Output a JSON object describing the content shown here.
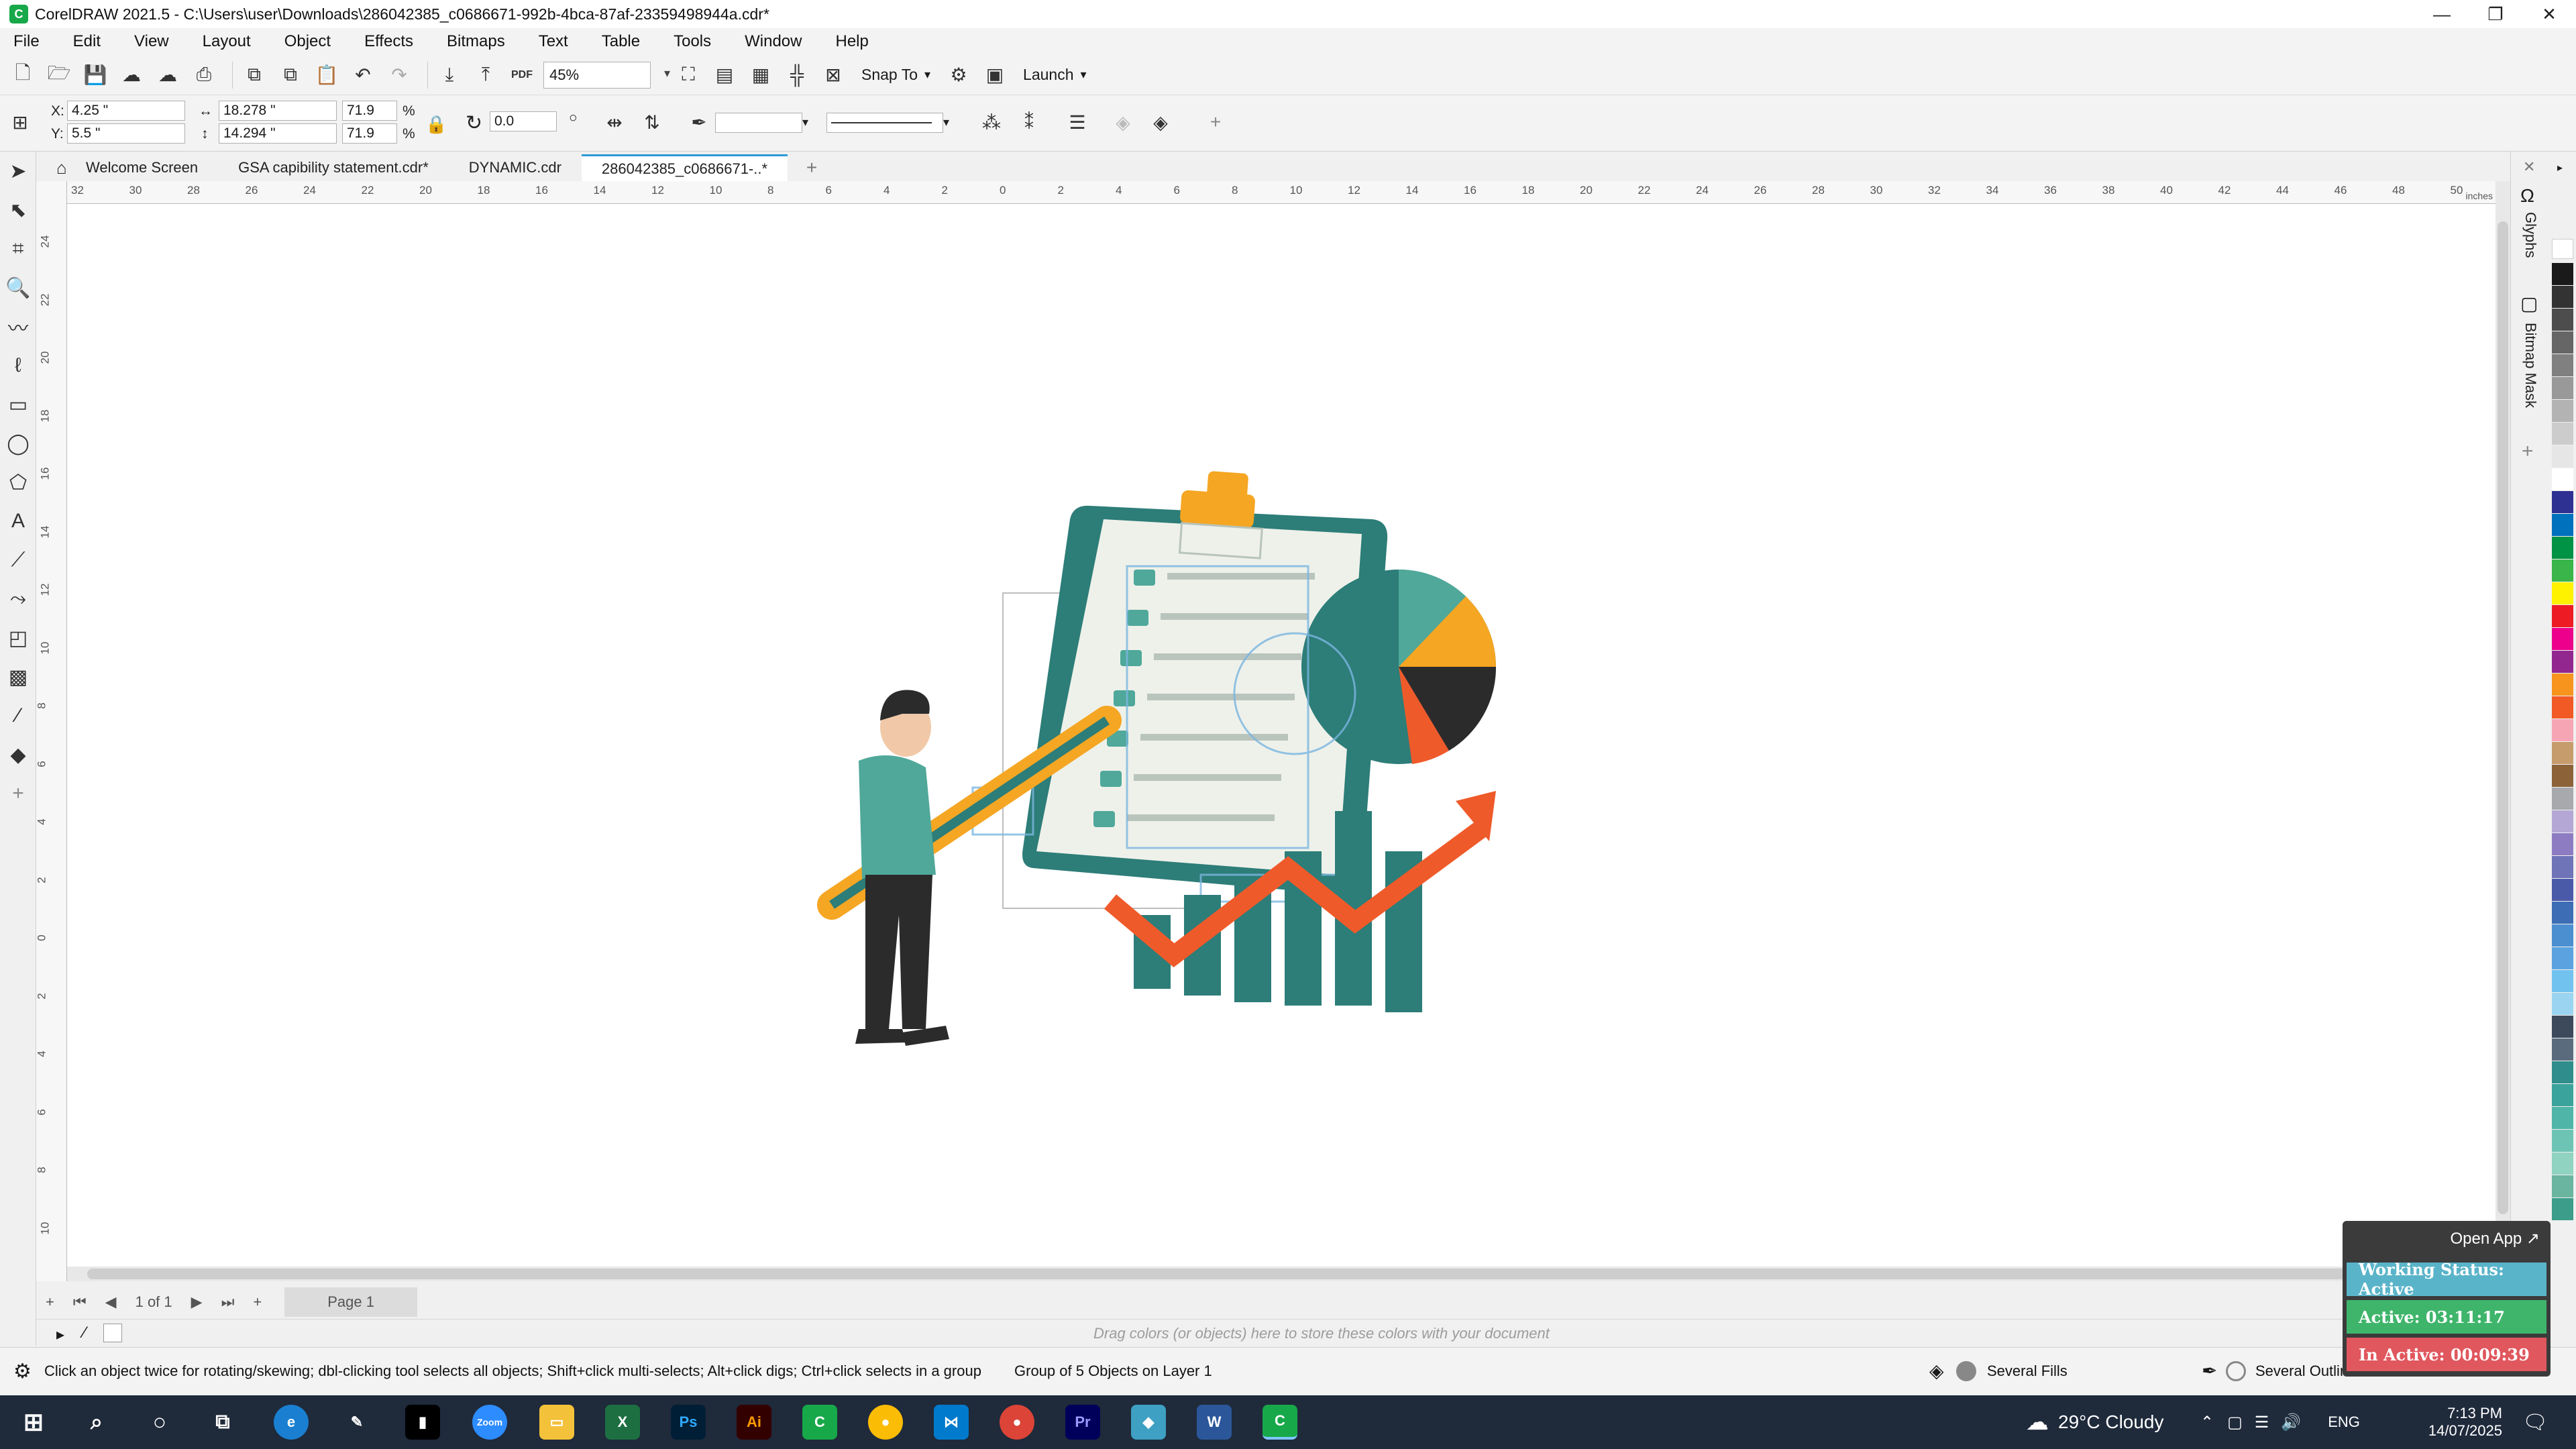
{
  "window": {
    "title": "CorelDRAW 2021.5 - C:\\Users\\user\\Downloads\\286042385_c0686671-992b-4bca-87af-23359498944a.cdr*"
  },
  "menu": [
    "File",
    "Edit",
    "View",
    "Layout",
    "Object",
    "Effects",
    "Bitmaps",
    "Text",
    "Table",
    "Tools",
    "Window",
    "Help"
  ],
  "toolbar": {
    "zoom": "45%",
    "snap_label": "Snap To",
    "launch_label": "Launch"
  },
  "properties": {
    "x_label": "X:",
    "x_value": "4.25 \"",
    "y_label": "Y:",
    "y_value": "5.5 \"",
    "width_value": "18.278 \"",
    "height_value": "14.294 \"",
    "scale_w": "71.9",
    "scale_h": "71.9",
    "percent": "%",
    "rotation": "0.0"
  },
  "tabs": [
    "Welcome Screen",
    "GSA  capibility statement.cdr*",
    "DYNAMIC.cdr",
    "286042385_c0686671-..*"
  ],
  "ruler": {
    "h_labels": [
      "32",
      "30",
      "28",
      "26",
      "24",
      "22",
      "20",
      "18",
      "16",
      "14",
      "12",
      "10",
      "8",
      "6",
      "4",
      "2",
      "0",
      "2",
      "4",
      "6",
      "8",
      "10",
      "12",
      "14",
      "16",
      "18",
      "20",
      "22",
      "24",
      "26",
      "28",
      "30",
      "32",
      "34",
      "36",
      "38",
      "40",
      "42",
      "44",
      "46",
      "48",
      "50"
    ],
    "v_labels": [
      "24",
      "22",
      "20",
      "18",
      "16",
      "14",
      "12",
      "10",
      "8",
      "6",
      "4",
      "2",
      "0",
      "2",
      "4",
      "6",
      "8",
      "10"
    ],
    "unit": "inches"
  },
  "page_nav": {
    "count": "1 of 1",
    "page_tab": "Page 1"
  },
  "color_tray_hint": "Drag colors (or objects) here to store these colors with your document",
  "status": {
    "hint": "Click an object twice for rotating/skewing; dbl-clicking tool selects all objects; Shift+click multi-selects; Alt+click digs; Ctrl+click selects in a group",
    "selection": "Group of 5 Objects on Layer 1",
    "fill": "Several Fills",
    "outline": "Several Outlin"
  },
  "dockers": {
    "glyphs": "Glyphs",
    "bitmap_mask": "Bitmap Mask"
  },
  "widget": {
    "open_app": "Open App ↗",
    "working_status": "Working Status: Active",
    "active": "Active: 03:11:17",
    "inactive": "In Active: 00:09:39",
    "colors": {
      "working": "#5ab4c9",
      "active": "#3fb56b",
      "inactive": "#e0575e"
    }
  },
  "taskbar": {
    "weather": "29°C  Cloudy",
    "lang": "ENG",
    "time": "7:13 PM",
    "date": "14/07/2025",
    "apps": [
      "Zoom",
      "Ps",
      "Ai",
      "Pr",
      "W"
    ]
  },
  "palette": [
    "#1a1a1a",
    "#333333",
    "#4d4d4d",
    "#666666",
    "#808080",
    "#999999",
    "#b3b3b3",
    "#cccccc",
    "#e6e6e6",
    "#ffffff",
    "#2e3192",
    "#0071bc",
    "#009245",
    "#39b54a",
    "#fff200",
    "#ed1c24",
    "#ec008c",
    "#92278f",
    "#f7941d",
    "#f15a24",
    "#f6a5b4",
    "#c69c6d",
    "#8c6239",
    "#a7a9ac",
    "#b4a7d6",
    "#8e7cc3",
    "#6f73b8",
    "#4a5aa8",
    "#3d6db5",
    "#4b8fd0",
    "#5ba3e0",
    "#72c2ef",
    "#9ad4f0",
    "#3c4a5c",
    "#5a6b7d",
    "#2f8e8b",
    "#3aa39b",
    "#4fb5a8",
    "#6ec4b4",
    "#8fd3c0",
    "#6ab5a0",
    "#3c9d8a"
  ],
  "illustration": {
    "colors": {
      "teal": "#2d7d78",
      "teal_light": "#4fa89a",
      "orange": "#f5a623",
      "red_orange": "#ef5a2a",
      "dark": "#2b2b2b",
      "paper": "#eef1ea"
    }
  }
}
